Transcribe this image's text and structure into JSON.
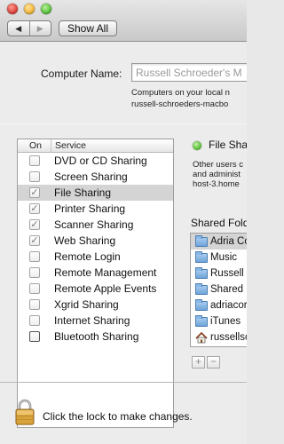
{
  "window": {
    "traffic_lights": [
      "close",
      "minimize",
      "zoom"
    ]
  },
  "toolbar": {
    "back_icon": "left-arrow-icon",
    "forward_icon": "right-arrow-icon",
    "back_glyph": "◀",
    "forward_glyph": "▶",
    "show_all_label": "Show All"
  },
  "computer_name": {
    "label": "Computer Name:",
    "value": "Russell Schroeder's M",
    "note_line1": "Computers on your local n",
    "note_line2": "russell-schroeders-macbo"
  },
  "services": {
    "header_on": "On",
    "header_service": "Service",
    "items": [
      {
        "label": "DVD or CD Sharing",
        "checked": false,
        "selected": false
      },
      {
        "label": "Screen Sharing",
        "checked": false,
        "selected": false
      },
      {
        "label": "File Sharing",
        "checked": true,
        "selected": true
      },
      {
        "label": "Printer Sharing",
        "checked": true,
        "selected": false
      },
      {
        "label": "Scanner Sharing",
        "checked": true,
        "selected": false
      },
      {
        "label": "Web Sharing",
        "checked": true,
        "selected": false
      },
      {
        "label": "Remote Login",
        "checked": false,
        "selected": false
      },
      {
        "label": "Remote Management",
        "checked": false,
        "selected": false
      },
      {
        "label": "Remote Apple Events",
        "checked": false,
        "selected": false
      },
      {
        "label": "Xgrid Sharing",
        "checked": false,
        "selected": false
      },
      {
        "label": "Internet Sharing",
        "checked": false,
        "selected": false
      },
      {
        "label": "Bluetooth Sharing",
        "checked": false,
        "selected": false
      }
    ]
  },
  "detail": {
    "status_text": "File Sha",
    "status_color": "#52b830",
    "info_line1": "Other users c",
    "info_line2": "and administ",
    "info_line3": "host-3.home",
    "shared_folders_label": "Shared Fold",
    "shared_folders": [
      {
        "label": "Adria Co",
        "icon": "folder-icon",
        "selected": true
      },
      {
        "label": "Music",
        "icon": "folder-icon",
        "selected": false
      },
      {
        "label": "Russell S",
        "icon": "folder-icon",
        "selected": false
      },
      {
        "label": "Shared",
        "icon": "folder-icon",
        "selected": false
      },
      {
        "label": "adriacor",
        "icon": "folder-icon",
        "selected": false
      },
      {
        "label": "iTunes",
        "icon": "folder-icon",
        "selected": false
      },
      {
        "label": "russellsc",
        "icon": "home-icon",
        "selected": false
      }
    ],
    "add_label": "+",
    "remove_label": "−"
  },
  "footer": {
    "lock_icon": "lock-icon",
    "lock_text": "Click the lock to make changes."
  }
}
